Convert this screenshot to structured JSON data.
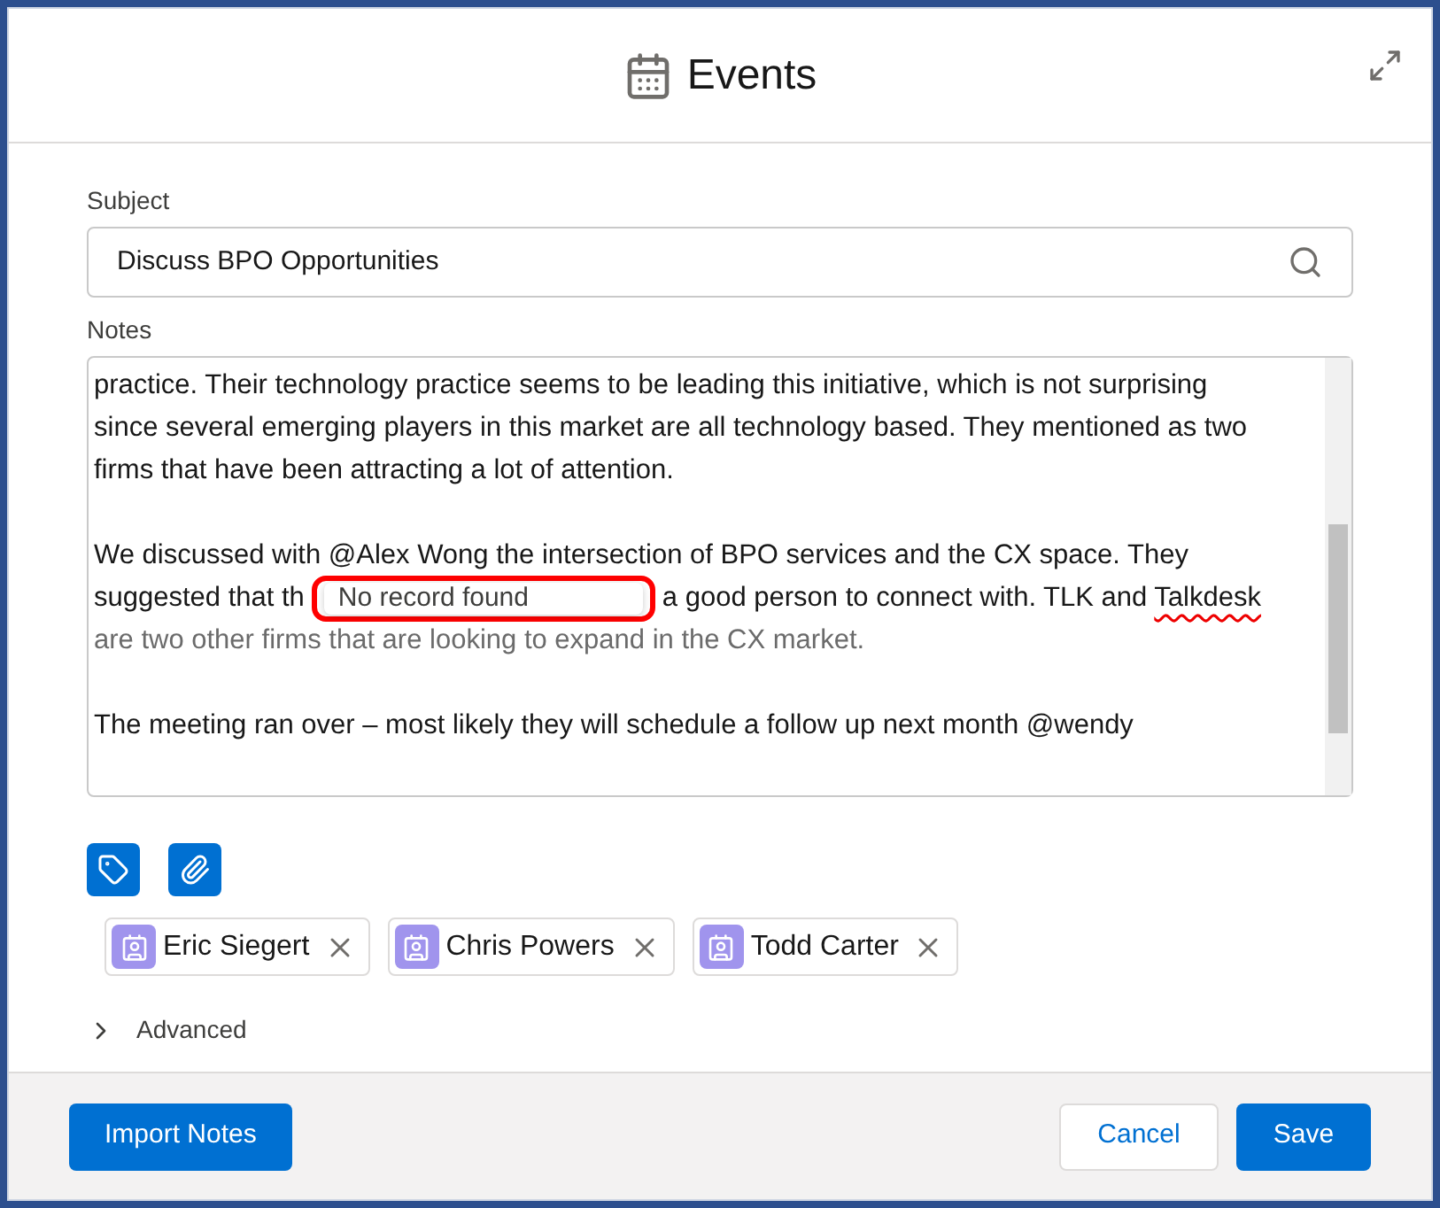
{
  "modal": {
    "title": "Events"
  },
  "subject": {
    "label": "Subject",
    "value": "Discuss BPO Opportunities"
  },
  "notes": {
    "label": "Notes",
    "lines": [
      {
        "kind": "text",
        "text": "practice. Their technology practice seems to be leading this initiative, which is not surprising"
      },
      {
        "kind": "text",
        "text": "since several emerging players in this market are all technology based. They mentioned  as two"
      },
      {
        "kind": "text",
        "text": "firms that have been attracting a lot of attention."
      },
      {
        "kind": "blank"
      },
      {
        "kind": "text",
        "text": "We discussed with @Alex Wong the intersection of BPO services and the CX space. They"
      },
      {
        "kind": "popup",
        "before": "suggested that th",
        "popup": "No record found",
        "after": "a good person to connect with. TLK and",
        "misspelled": "Talkdesk"
      },
      {
        "kind": "faded",
        "text": "are two other firms that are looking to expand in the CX market."
      },
      {
        "kind": "blank"
      },
      {
        "kind": "text",
        "text": "The meeting ran over – most likely they will schedule a follow up next month @wendy"
      }
    ]
  },
  "contacts": [
    {
      "name": "Eric Siegert"
    },
    {
      "name": "Chris Powers"
    },
    {
      "name": "Todd Carter"
    }
  ],
  "advanced": {
    "label": "Advanced",
    "expanded": false
  },
  "footer": {
    "import": "Import Notes",
    "cancel": "Cancel",
    "save": "Save"
  }
}
